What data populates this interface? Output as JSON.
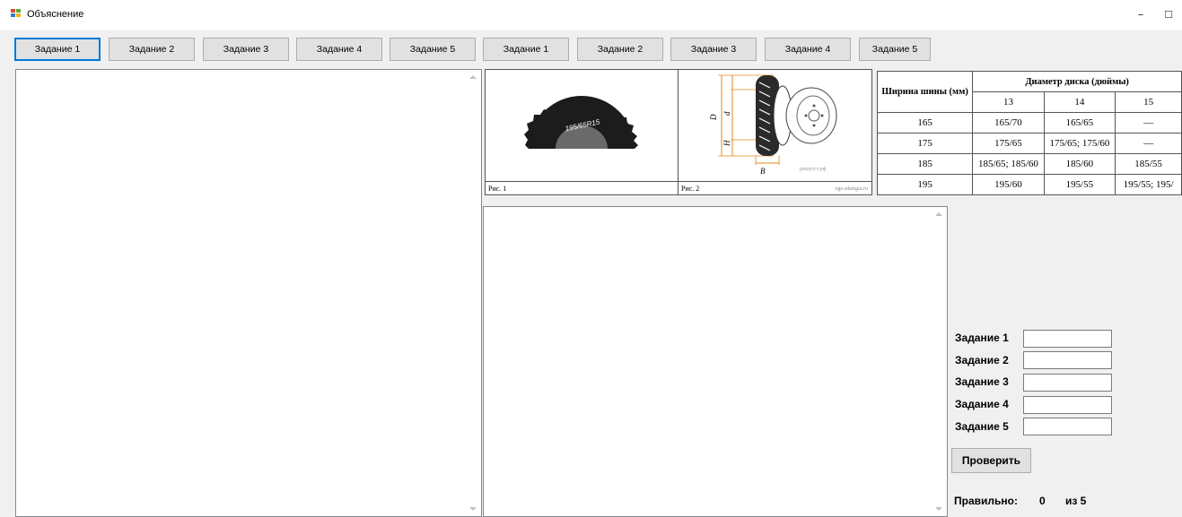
{
  "window": {
    "title": "Объяснение",
    "minimize": "–",
    "maximize": "☐"
  },
  "tabs_left": [
    "Задание 1",
    "Задание 2",
    "Задание 3",
    "Задание 4",
    "Задание 5"
  ],
  "tabs_right": [
    "Задание 1",
    "Задание 2",
    "Задание 3",
    "Задание 4",
    "Задание 5"
  ],
  "figure": {
    "tyre_marking": "195/65R15",
    "caption1": "Рис. 1",
    "caption2": "Рис. 2",
    "source": "oge.sdamgia.ru",
    "watermark": "решуогэ.рф",
    "dim_D": "D",
    "dim_d": "d",
    "dim_H": "H",
    "dim_B": "B"
  },
  "tyre_table": {
    "col_header": "Ширина шины (мм)",
    "group_header": "Диаметр диска (дюймы)",
    "diameters": [
      "13",
      "14",
      "15"
    ],
    "rows": [
      {
        "width": "165",
        "values": [
          "165/70",
          "165/65",
          "—"
        ]
      },
      {
        "width": "175",
        "values": [
          "175/65",
          "175/65; 175/60",
          "—"
        ]
      },
      {
        "width": "185",
        "values": [
          "185/65; 185/60",
          "185/60",
          "185/55"
        ]
      },
      {
        "width": "195",
        "values": [
          "195/60",
          "195/55",
          "195/55; 195/"
        ]
      }
    ]
  },
  "answers": {
    "labels": [
      "Задание 1",
      "Задание 2",
      "Задание 3",
      "Задание 4",
      "Задание 5"
    ],
    "values": [
      "",
      "",
      "",
      "",
      ""
    ],
    "check_button": "Проверить"
  },
  "result": {
    "label": "Правильно:",
    "correct": "0",
    "of_total": "из 5"
  },
  "colors": {
    "accent": "#0078d7",
    "window_bg": "#f0f0f0",
    "button_bg": "#e1e1e1"
  }
}
